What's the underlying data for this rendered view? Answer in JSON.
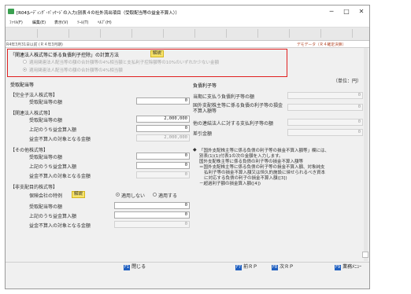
{
  "window": {
    "title": "[R04]ﾚｰﾃﾞｨﾝｸﾞ･ﾊﾟｯｹｰｼﾞの入力(別表４の社外流出項目（受取配当等の益金不算入））",
    "minimize": "─",
    "maximize": "□",
    "close": "✕"
  },
  "menu": [
    "ﾌｧｲﾙ(F)",
    "編集(E)",
    "表示(V)",
    "ﾂｰﾙ(T)",
    "ﾍﾙﾌﾟ(H)"
  ],
  "info": {
    "period": "R4年3月31日以前 (Ｒ４年3月期)",
    "mode": "デモデータ（Ｒ４確定決算）"
  },
  "method": {
    "heading": "「関連法人株式等に係る負債利子控除」の計算方法",
    "help_label": "解説",
    "option1": "適用関連法人配当等の額の合計額等の4%相当額と支払利子控除額等の10%のいずれか少ない金額",
    "option2": "適用関連法人配当等の額の合計額等の4%相当額"
  },
  "dividends": {
    "title": "受取配当等",
    "sections": [
      {
        "heading": "【完全子法人株式等】",
        "rows": [
          {
            "label": "受取配当等の額",
            "value": "0",
            "readonly": false
          }
        ]
      },
      {
        "heading": "【関連法人株式等】",
        "rows": [
          {
            "label": "受取配当等の額",
            "value": "2,000,000",
            "readonly": false
          },
          {
            "label": "上記のうち益金算入額",
            "value": "0",
            "readonly": false
          },
          {
            "label": "益金不算入の対象となる金額",
            "value": "2,000,000",
            "readonly": true
          }
        ]
      },
      {
        "heading": "【その他株式等】",
        "rows": [
          {
            "label": "受取配当等の額",
            "value": "0",
            "readonly": false
          },
          {
            "label": "上記のうち益金算入額",
            "value": "0",
            "readonly": false
          },
          {
            "label": "益金不算入の対象となる金額",
            "value": "0",
            "readonly": true
          }
        ]
      }
    ],
    "nonctrl": {
      "heading": "【非支配目的株式等】",
      "special_label": "保険会社の特例",
      "help_label": "解説",
      "no_apply": "適用しない",
      "apply": "適用する",
      "rows": [
        {
          "label": "受取配当等の額",
          "value": "0",
          "readonly": false
        },
        {
          "label": "上記のうち益金算入額",
          "value": "0",
          "readonly": false
        },
        {
          "label": "益金不算入の対象となる金額",
          "value": "0",
          "readonly": true
        }
      ]
    }
  },
  "interest": {
    "title": "負債利子等",
    "unit": "（単位：円）",
    "rows": [
      {
        "label": "当期に支払う負債利子等の額",
        "value": "0"
      },
      {
        "label": "国外支配株主等に係る負債の利子等の損金不算入額等",
        "value": "0"
      },
      {
        "label": "他の連結法人に対する支払利子等の額",
        "value": "0"
      },
      {
        "label": "差引金額",
        "value": "0"
      }
    ]
  },
  "note": {
    "bullet": "◆",
    "line1": "「国外支配株主等に係る負債の利子等の損金不算入額等」欄には、",
    "line2": "別表(1)(1)付表1の次の金額を入力します。",
    "line3": "国外支配株主等に係る負債の利子等の損金不算入額等",
    "line4": "＝国外支配株主等に係る負債の利子等の損金不算入額、対象純支",
    "line5": "払利子等の損金不算入額又は恒久的施設に帰せられるべき資本",
    "line6": "に対応する負債の利子の損金不算入額([3])",
    "line7": "－超過利子額の損金算入額([4])"
  },
  "footer": {
    "close_key": "F1",
    "close_label": "閉じる",
    "prev_key": "F7",
    "prev_label": "前ＲＰ",
    "next_key": "F8",
    "next_label": "次ＲＰ",
    "menu_key": "F9",
    "menu_label": "業務ﾒﾆｭｰ"
  }
}
